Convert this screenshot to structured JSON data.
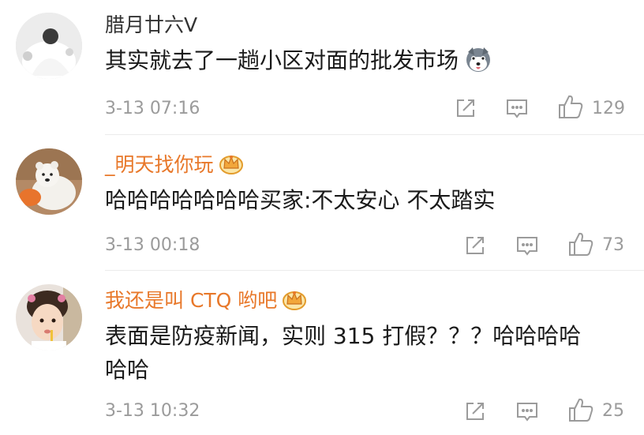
{
  "comments": [
    {
      "username": "腊月廿六V",
      "text": "其实就去了一趟小区对面的批发市场",
      "emoji": "husky-face-emoji",
      "time": "3-13 07:16",
      "likes": "129",
      "vip": false
    },
    {
      "username": "_明天找你玩",
      "text": "哈哈哈哈哈哈哈买家:不太安心 不太踏实",
      "time": "3-13 00:18",
      "likes": "73",
      "vip": true
    },
    {
      "username": "我还是叫 CTQ 哟吧",
      "text_line1": "表面是防疫新闻，实则 315 打假？？？哈哈哈哈",
      "text_line2": "哈哈",
      "time": "3-13 10:32",
      "likes": "25",
      "vip": true
    }
  ],
  "colors": {
    "vip_name": "#e8782a",
    "meta_gray": "#9b9b9b",
    "text": "#1a1a1a"
  },
  "icons": [
    "share-icon",
    "comment-icon",
    "like-icon",
    "vip-crown-icon"
  ]
}
